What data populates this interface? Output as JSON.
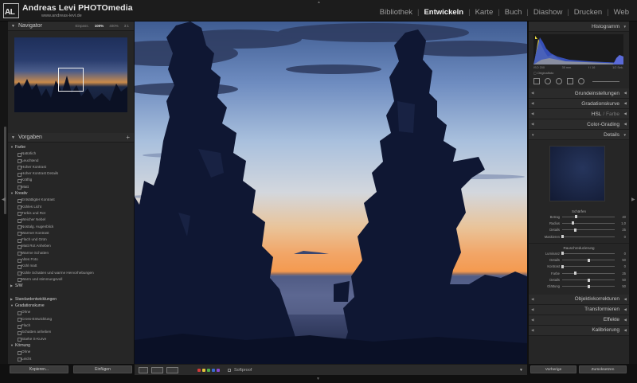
{
  "identity": {
    "logo": "AL",
    "name": "Andreas Levi PHOTOmedia",
    "url": "www.andreas-levi.de"
  },
  "modules": [
    {
      "label": "Bibliothek",
      "active": false
    },
    {
      "label": "Entwickeln",
      "active": true
    },
    {
      "label": "Karte",
      "active": false
    },
    {
      "label": "Buch",
      "active": false
    },
    {
      "label": "Diashow",
      "active": false
    },
    {
      "label": "Drucken",
      "active": false
    },
    {
      "label": "Web",
      "active": false
    }
  ],
  "navigator": {
    "title": "Navigator",
    "zoom": [
      "Einpass.",
      "100%",
      "400%",
      "3:1"
    ]
  },
  "presets": {
    "title": "Vorgaben",
    "groups": [
      {
        "name": "Farbe",
        "items": [
          "Natürlich",
          "Leuchtend",
          "Hoher Kontrast",
          "Hoher Kontrast Details",
          "Kräftig",
          "Matt"
        ]
      },
      {
        "name": "Kreativ",
        "items": [
          "Entsättigter Kontrast",
          "Kühles Licht",
          "Türkis und Rot",
          "Weicher Nebel",
          "Nostalg. Augenblick",
          "Warmer Kontrast",
          "Flach und Grün",
          "Matt Rot Anheben",
          "Warme Schatten",
          "Altes Foto",
          "Kühl matt",
          "Kühle Schatten und warme Hervorhebungen",
          "Warm und stimmungsvoll"
        ]
      },
      {
        "name": "S/W",
        "items": []
      },
      {
        "name": "Standardentwicklungen",
        "items": []
      },
      {
        "name": "Gradationskurve",
        "items": [
          "Ohne",
          "Cross-Entwicklung",
          "Flach",
          "Schatten anheben",
          "Starke S-Kurve"
        ]
      },
      {
        "name": "Körnung",
        "items": [
          "Ohne",
          "Leicht"
        ]
      }
    ]
  },
  "left_buttons": {
    "copy": "Kopieren...",
    "paste": "Einfügen"
  },
  "toolbar": {
    "softproof": "Softproof",
    "colors": [
      "#d23a3a",
      "#e0c23a",
      "#4fb04a",
      "#3a6ad2",
      "#8a4ad2"
    ]
  },
  "right": {
    "histogram_title": "Histogramm",
    "histogram_readout": [
      "ISO 200",
      "35 mm",
      "f / 16",
      "1/2 Sek."
    ],
    "original_label": "Originalfoto",
    "panels_top": [
      "Grundeinstellungen",
      "Gradationskurve",
      "HSL / Farbe",
      "Color-Grading",
      "Details"
    ],
    "hsl_main": "HSL",
    "hsl_sub": "/ Farbe",
    "sharpen_title": "Schärfen",
    "sharpen": [
      {
        "label": "Betrag",
        "value": "40",
        "pos": 0.27
      },
      {
        "label": "Radius",
        "value": "1,0",
        "pos": 0.2
      },
      {
        "label": "Details",
        "value": "25",
        "pos": 0.25
      },
      {
        "label": "Maskieren",
        "value": "0",
        "pos": 0.0
      }
    ],
    "noise_title": "Rauschreduzierung",
    "noise": [
      {
        "label": "Luminanz",
        "value": "0",
        "pos": 0.0
      },
      {
        "label": "Details",
        "value": "50",
        "pos": 0.5
      },
      {
        "label": "Kontrast",
        "value": "0",
        "pos": 0.0
      },
      {
        "label": "Farbe",
        "value": "25",
        "pos": 0.25
      },
      {
        "label": "Details",
        "value": "50",
        "pos": 0.5
      },
      {
        "label": "Glättung",
        "value": "50",
        "pos": 0.5
      }
    ],
    "panels_bottom": [
      "Objektivkorrekturen",
      "Transformieren",
      "Effekte",
      "Kalibrierung"
    ],
    "buttons": {
      "previous": "Vorherige",
      "reset": "Zurücksetzen"
    }
  }
}
